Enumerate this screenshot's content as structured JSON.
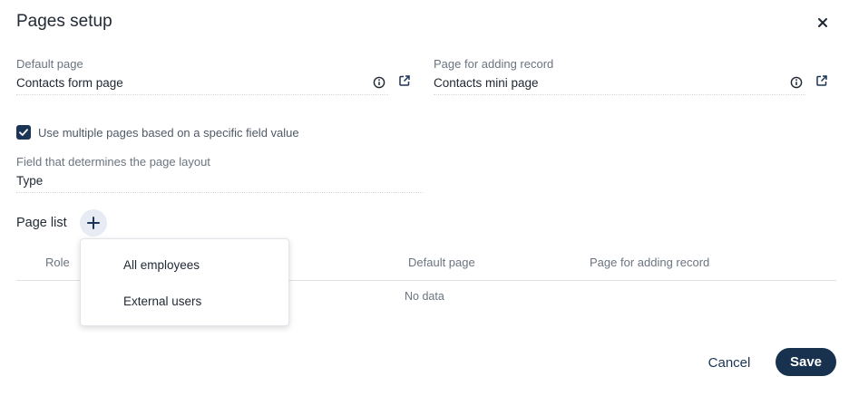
{
  "dialog": {
    "title": "Pages setup"
  },
  "default_page": {
    "label": "Default page",
    "value": "Contacts form page"
  },
  "add_record_page": {
    "label": "Page for adding record",
    "value": "Contacts mini page"
  },
  "multi_pages": {
    "checked": true,
    "label": "Use multiple pages based on a specific field value"
  },
  "layout_field": {
    "label": "Field that determines the page layout",
    "value": "Type"
  },
  "page_list": {
    "label": "Page list",
    "columns": [
      "Role",
      "Default page",
      "Page for adding record"
    ],
    "empty_text": "No data"
  },
  "role_dropdown": {
    "items": [
      "All employees",
      "External users"
    ]
  },
  "footer": {
    "cancel_label": "Cancel",
    "save_label": "Save"
  },
  "colors": {
    "primary": "#17314f",
    "accent_bg": "#e7ecf4"
  }
}
